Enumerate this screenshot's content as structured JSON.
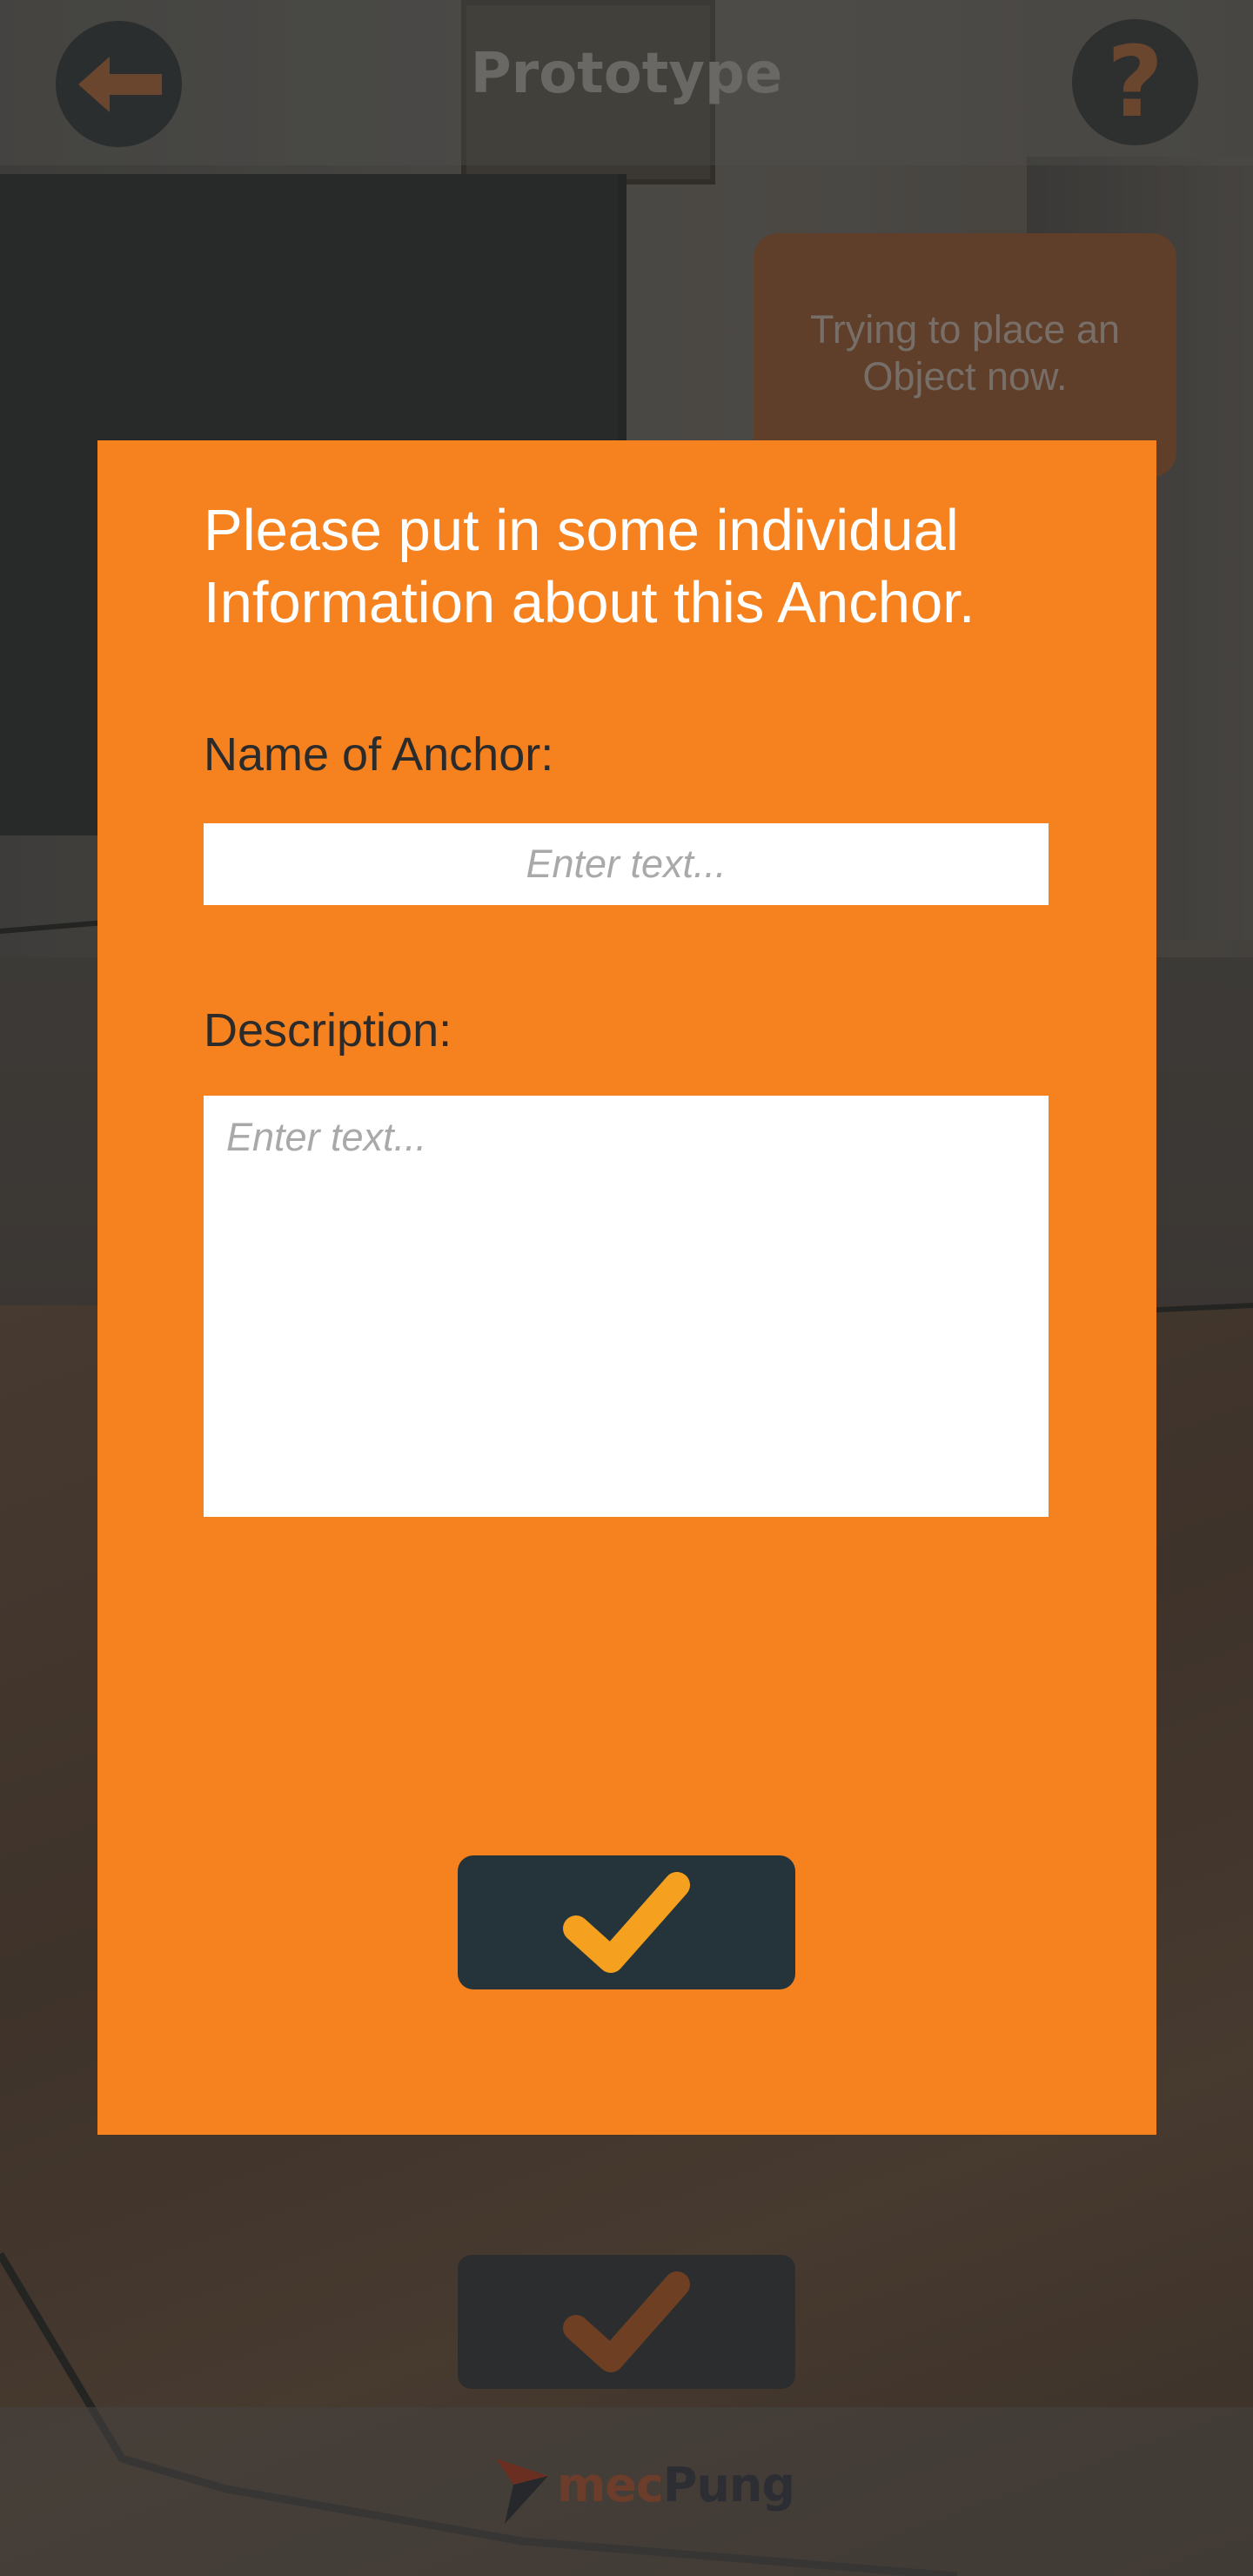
{
  "app": {
    "title": "Prototype"
  },
  "header": {
    "back_icon": "arrow-left-icon",
    "help_icon": "question-mark-icon",
    "help_glyph": "?"
  },
  "status": {
    "text": "Trying to place an Object now."
  },
  "dialog": {
    "heading": "Please put in some individual Information about this Anchor.",
    "name_label": "Name of Anchor:",
    "name_placeholder": "Enter text...",
    "name_value": "",
    "description_label": "Description:",
    "description_placeholder": "Enter text...",
    "description_value": "",
    "confirm_icon": "checkmark-icon"
  },
  "footer": {
    "brand_part1": "mec",
    "brand_part2": "Pung",
    "confirm_icon": "checkmark-icon"
  },
  "colors": {
    "accent": "#f5821f",
    "dark_button": "#25343a",
    "check": "#f5a01f",
    "text_dark": "#2b2b2b",
    "text_light": "#ffffff"
  }
}
